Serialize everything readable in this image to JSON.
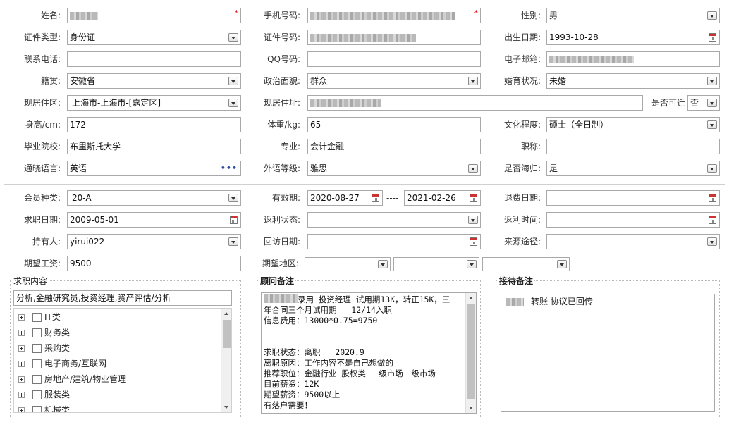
{
  "form": {
    "name_label": "姓名:",
    "phone_label": "手机号码:",
    "gender_label": "性别:",
    "gender_value": "男",
    "id_type_label": "证件类型:",
    "id_type_value": "身份证",
    "id_no_label": "证件号码:",
    "birth_label": "出生日期:",
    "birth_value": "1993-10-28",
    "tel_label": "联系电话:",
    "qq_label": "QQ号码:",
    "email_label": "电子邮箱:",
    "native_label": "籍贯:",
    "native_value": "安徽省",
    "political_label": "政治面貌:",
    "political_value": "群众",
    "marital_label": "婚育状况:",
    "marital_value": "未婚",
    "residence_label": "现居住区:",
    "residence_value": "上海市-上海市-[嘉定区]",
    "address_label": "现居住址:",
    "relocate_label": "是否可迁",
    "relocate_value": "否",
    "height_label": "身高/cm:",
    "height_value": "172",
    "weight_label": "体重/kg:",
    "weight_value": "65",
    "education_label": "文化程度:",
    "education_value": "硕士（全日制）",
    "school_label": "毕业院校:",
    "school_value": "布里斯托大学",
    "major_label": "专业:",
    "major_value": "会计金融",
    "title_label": "职称:",
    "language_label": "通晓语言:",
    "language_value": "英语",
    "language_more": "•••",
    "lang_level_label": "外语等级:",
    "lang_level_value": "雅思",
    "overseas_label": "是否海归:",
    "overseas_value": "是"
  },
  "membership": {
    "type_label": "会员种类:",
    "type_value": "20-A",
    "valid_label": "有效期:",
    "valid_from": "2020-08-27",
    "valid_sep": "----",
    "valid_to": "2021-02-26",
    "refund_date_label": "退费日期:",
    "apply_date_label": "求职日期:",
    "apply_date_value": "2009-05-01",
    "rebate_status_label": "返利状态:",
    "rebate_time_label": "返利时间:",
    "holder_label": "持有人:",
    "holder_value": "yirui022",
    "revisit_label": "回访日期:",
    "source_label": "来源途径:",
    "salary_label": "期望工资:",
    "salary_value": "9500",
    "region_label": "期望地区:"
  },
  "job_intent": {
    "legend": "求职内容",
    "summary": "分析,金融研究员,投资经理,资产评估/分析",
    "categories": [
      "IT类",
      "财务类",
      "采购类",
      "电子商务/互联网",
      "房地产/建筑/物业管理",
      "服装类",
      "机械类"
    ]
  },
  "consultant_notes": {
    "legend": "顾问备注",
    "line1": "录用 投资经理 试用期13K，转正15K，三",
    "text": "年合同三个月试用期   12/14入职\n信息费用：13000*0.75=9750\n\n\n求职状态：离职   2020.9\n离职原因：工作内容不是自己想做的\n推荐职位：金融行业 股权类 一级市场二级市场\n目前薪资：12K\n期望薪资：9500以上\n有落户需要！"
  },
  "reception_notes": {
    "legend": "接待备注",
    "text": "转账 协议已回传"
  },
  "colors": {
    "required": "#e00000",
    "border": "#a9a9a9"
  }
}
